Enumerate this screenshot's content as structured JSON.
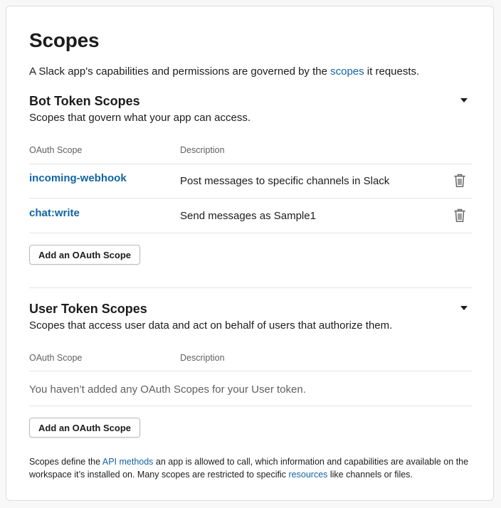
{
  "page": {
    "title": "Scopes",
    "intro_before": "A Slack app's capabilities and permissions are governed by the ",
    "intro_link": "scopes",
    "intro_after": " it requests."
  },
  "bot": {
    "title": "Bot Token Scopes",
    "description": "Scopes that govern what your app can access.",
    "col_scope": "OAuth Scope",
    "col_desc": "Description",
    "scopes": [
      {
        "name": "incoming-webhook",
        "description": "Post messages to specific channels in Slack"
      },
      {
        "name": "chat:write",
        "description": "Send messages as Sample1"
      }
    ],
    "add_button": "Add an OAuth Scope"
  },
  "user": {
    "title": "User Token Scopes",
    "description": "Scopes that access user data and act on behalf of users that authorize them.",
    "col_scope": "OAuth Scope",
    "col_desc": "Description",
    "empty": "You haven’t added any OAuth Scopes for your User token.",
    "add_button": "Add an OAuth Scope"
  },
  "footer": {
    "t1": "Scopes define the ",
    "link1": "API methods",
    "t2": " an app is allowed to call, which information and capabilities are available on the workspace it’s installed on. Many scopes are restricted to specific ",
    "link2": "resources",
    "t3": " like channels or files."
  },
  "icons": {
    "delete": "trash-icon",
    "collapse": "caret-down-icon"
  },
  "colors": {
    "link": "#1264a3",
    "text": "#1d1c1d",
    "muted": "#616061"
  }
}
